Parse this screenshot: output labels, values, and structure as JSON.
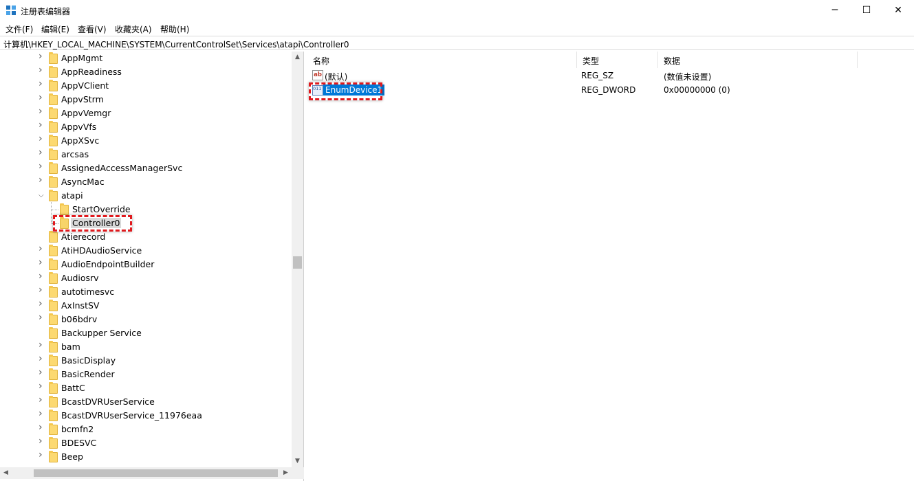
{
  "window": {
    "title": "注册表编辑器",
    "minimize_glyph": "─",
    "maximize_glyph": "☐",
    "close_glyph": "✕"
  },
  "menu": [
    "文件(F)",
    "编辑(E)",
    "查看(V)",
    "收藏夹(A)",
    "帮助(H)"
  ],
  "address": "计算机\\HKEY_LOCAL_MACHINE\\SYSTEM\\CurrentControlSet\\Services\\atapi\\Controller0",
  "tree": {
    "items": [
      {
        "label": "AppMgmt",
        "depth": 0,
        "expander": "collapsed"
      },
      {
        "label": "AppReadiness",
        "depth": 0,
        "expander": "collapsed"
      },
      {
        "label": "AppVClient",
        "depth": 0,
        "expander": "collapsed"
      },
      {
        "label": "AppvStrm",
        "depth": 0,
        "expander": "collapsed"
      },
      {
        "label": "AppvVemgr",
        "depth": 0,
        "expander": "collapsed"
      },
      {
        "label": "AppvVfs",
        "depth": 0,
        "expander": "collapsed"
      },
      {
        "label": "AppXSvc",
        "depth": 0,
        "expander": "collapsed"
      },
      {
        "label": "arcsas",
        "depth": 0,
        "expander": "collapsed"
      },
      {
        "label": "AssignedAccessManagerSvc",
        "depth": 0,
        "expander": "collapsed"
      },
      {
        "label": "AsyncMac",
        "depth": 0,
        "expander": "collapsed"
      },
      {
        "label": "atapi",
        "depth": 0,
        "expander": "expanded"
      },
      {
        "label": "StartOverride",
        "depth": 1,
        "expander": "none"
      },
      {
        "label": "Controller0",
        "depth": 1,
        "expander": "none",
        "selected": true
      },
      {
        "label": "Atierecord",
        "depth": 0,
        "expander": "none"
      },
      {
        "label": "AtiHDAudioService",
        "depth": 0,
        "expander": "collapsed"
      },
      {
        "label": "AudioEndpointBuilder",
        "depth": 0,
        "expander": "collapsed"
      },
      {
        "label": "Audiosrv",
        "depth": 0,
        "expander": "collapsed"
      },
      {
        "label": "autotimesvc",
        "depth": 0,
        "expander": "collapsed"
      },
      {
        "label": "AxInstSV",
        "depth": 0,
        "expander": "collapsed"
      },
      {
        "label": "b06bdrv",
        "depth": 0,
        "expander": "collapsed"
      },
      {
        "label": "Backupper Service",
        "depth": 0,
        "expander": "none"
      },
      {
        "label": "bam",
        "depth": 0,
        "expander": "collapsed"
      },
      {
        "label": "BasicDisplay",
        "depth": 0,
        "expander": "collapsed"
      },
      {
        "label": "BasicRender",
        "depth": 0,
        "expander": "collapsed"
      },
      {
        "label": "BattC",
        "depth": 0,
        "expander": "collapsed"
      },
      {
        "label": "BcastDVRUserService",
        "depth": 0,
        "expander": "collapsed"
      },
      {
        "label": "BcastDVRUserService_11976eaa",
        "depth": 0,
        "expander": "collapsed"
      },
      {
        "label": "bcmfn2",
        "depth": 0,
        "expander": "collapsed"
      },
      {
        "label": "BDESVC",
        "depth": 0,
        "expander": "collapsed"
      },
      {
        "label": "Beep",
        "depth": 0,
        "expander": "collapsed"
      }
    ]
  },
  "values": {
    "headers": {
      "name": "名称",
      "type": "类型",
      "data": "数据"
    },
    "rows": [
      {
        "name": "(默认)",
        "type": "REG_SZ",
        "data": "(数值未设置)",
        "icon": "ab",
        "icon_text": "ab"
      },
      {
        "name": "EnumDevice1",
        "type": "REG_DWORD",
        "data": "0x00000000 (0)",
        "icon": "binary",
        "icon_text": "011 110",
        "selected": true
      }
    ]
  },
  "colors": {
    "selection": "#0078d7",
    "highlight_box": "#e0191d",
    "folder": "#fcd971"
  }
}
